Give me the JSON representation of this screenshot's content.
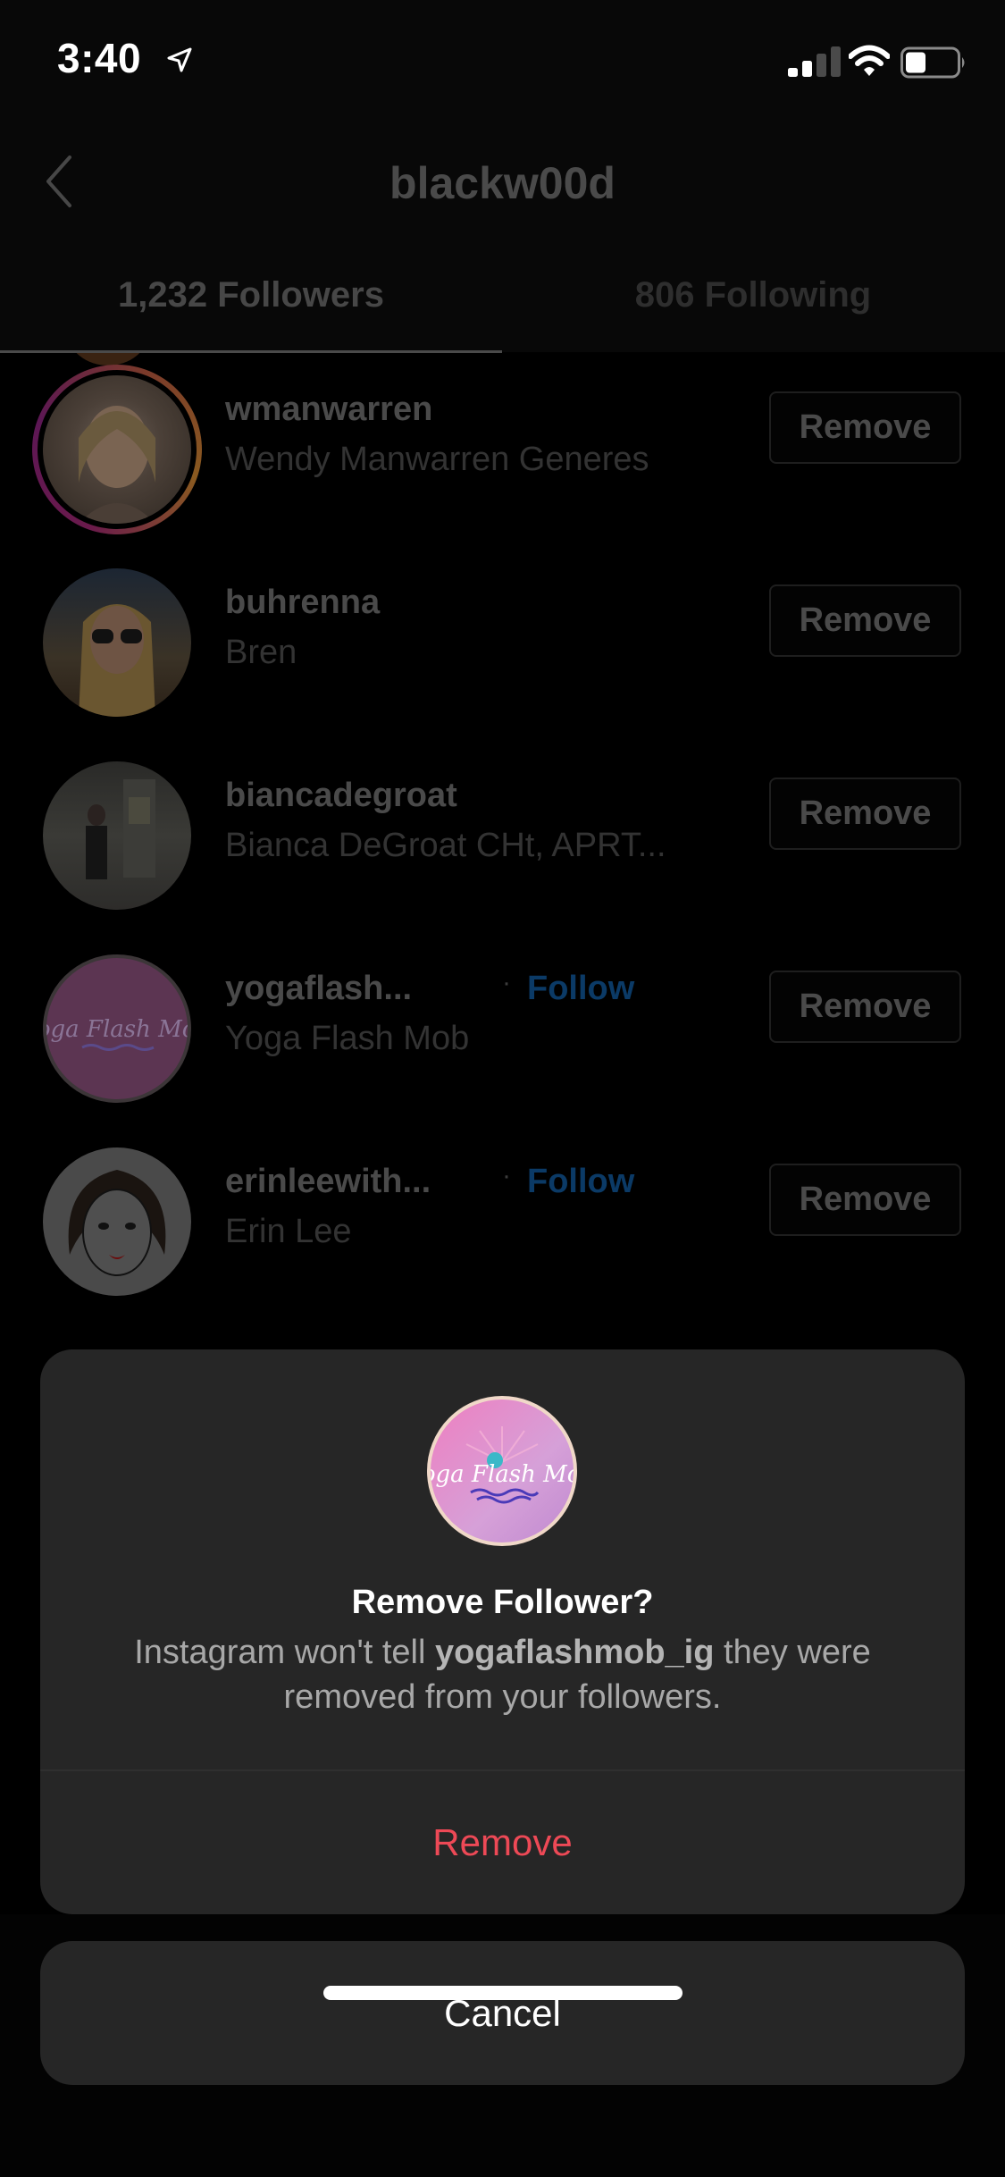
{
  "status_bar": {
    "time": "3:40",
    "location_icon": "location-arrow-icon",
    "signal_bars_active": 2,
    "signal_bars_total": 4,
    "wifi_icon": "wifi-icon",
    "battery_level": 0.4
  },
  "nav": {
    "back_icon": "chevron-left-icon",
    "title": "blackw00d"
  },
  "tabs": [
    {
      "label": "1,232 Followers",
      "active": true
    },
    {
      "label": "806 Following",
      "active": false
    }
  ],
  "followers": [
    {
      "username": "wmanwarren",
      "full_name": "Wendy Manwarren Generes",
      "has_story_ring": true,
      "follow_label": null,
      "action_label": "Remove"
    },
    {
      "username": "buhrenna",
      "full_name": "Bren",
      "has_story_ring": false,
      "follow_label": null,
      "action_label": "Remove"
    },
    {
      "username": "biancadegroat",
      "full_name": "Bianca DeGroat CHt, APRT...",
      "has_story_ring": false,
      "follow_label": null,
      "action_label": "Remove"
    },
    {
      "username": "yogaflash...",
      "full_name": "Yoga Flash Mob",
      "has_story_ring": false,
      "follow_label": "Follow",
      "separator": "·",
      "action_label": "Remove"
    },
    {
      "username": "erinleewith...",
      "full_name": "Erin Lee",
      "has_story_ring": false,
      "follow_label": "Follow",
      "separator": "·",
      "action_label": "Remove"
    }
  ],
  "dialog": {
    "title": "Remove Follower?",
    "message_prefix": "Instagram won't tell ",
    "message_username": "yogaflashmob_ig",
    "message_suffix": " they were removed from your followers.",
    "confirm_label": "Remove",
    "cancel_label": "Cancel",
    "avatar_text": "Yoga Flash Mob"
  },
  "colors": {
    "destructive": "#ed4956",
    "follow_link": "#0b3a66",
    "sheet_bg": "#262626"
  }
}
